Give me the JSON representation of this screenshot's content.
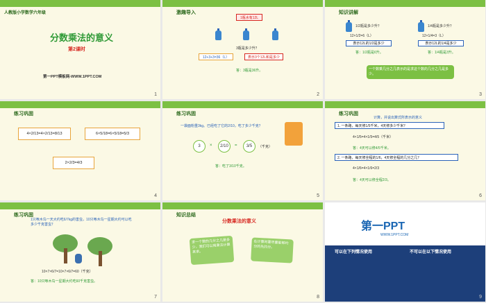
{
  "s1": {
    "top": "人教版小学数学六年级",
    "title": "分数乘法的意义",
    "sub": "第2课时",
    "site": "第一PPT模板网-WWW.1PPT.COM",
    "num": "1"
  },
  "s2": {
    "hdr": "激趣导入",
    "tag": "1瓶水有12L",
    "q": "3瓶是多少升？",
    "formula": "12+3+3=36（L）",
    "hint": "表示3个12L和是多少",
    "ans": "答：3瓶是36升。",
    "num": "2"
  },
  "s3": {
    "hdr": "知识讲解",
    "l1": "1/2瓶是多少升？",
    "l2": "12×1/2=6（L）",
    "l3": "表示12L的1/2是多少",
    "l4": "答：1/2瓶是6升。",
    "r1": "1/4瓶是多少升？",
    "r2": "12×1/4=3（L）",
    "r3": "表示12L的1/4是多少",
    "r4": "答：1/4瓶是3升。",
    "note": "一个数乘几分之几表示的是求这个数的几分之几是多少。",
    "num": "3"
  },
  "s4": {
    "hdr": "练习巩固",
    "a": "4×2/13=4×2/13=8/13",
    "b": "6×5/18=6×5/18=5/3",
    "c": "2×2/3=4/3",
    "num": "4"
  },
  "s5": {
    "hdr": "练习巩固",
    "q": "一袋面粉重3kg。已经吃了它的2/10，吃了多少千克？",
    "c1": "3",
    "op1": "×",
    "c2": "2/10",
    "op2": "=",
    "c3": "3/5",
    "unit": "（千克）",
    "ans": "答：吃了3/10千克。",
    "num": "5"
  },
  "s6": {
    "hdr": "练习巩固",
    "head": "计算，并说出算式所表示的意义",
    "q1": "1. 一条路，每天修1/5千米，4天修多少千米？",
    "e1": "4×1/5=4×1/5=4/5（千米）",
    "a1": "答：4天可以修4/5千米。",
    "q2": "2. 一条路，每天修全程的1/6，4天修全程的几分之几？",
    "e2": "4×1/6=4×1/6=2/3",
    "a2": "答：4天可以修全程2/3。",
    "num": "6"
  },
  "s7": {
    "hdr": "练习巩固",
    "q": "1只啄木鸟一天大约吃6/7kg的害虫，10只啄木鸟一星期大约可以吃多少千克害虫？",
    "e": "10×7×6/7=10×7×6/7=60（千克）",
    "ans": "答：10只啄木鸟一星期大约吃60千克害虫。",
    "num": "7"
  },
  "s8": {
    "hdr": "知识总结",
    "title": "分数乘法的意义",
    "b1": "求一个数的几分之几是多少，我们可以用乘法计算来求。",
    "b2": "在计算时要尽量能够约分的先约分。",
    "num": "8"
  },
  "s9": {
    "logo": "第一PPT",
    "url": "WWW.1PPT.COM",
    "h1": "可以在下列情况使用",
    "h2": "不可以在以下情况使用",
    "num": "9"
  }
}
